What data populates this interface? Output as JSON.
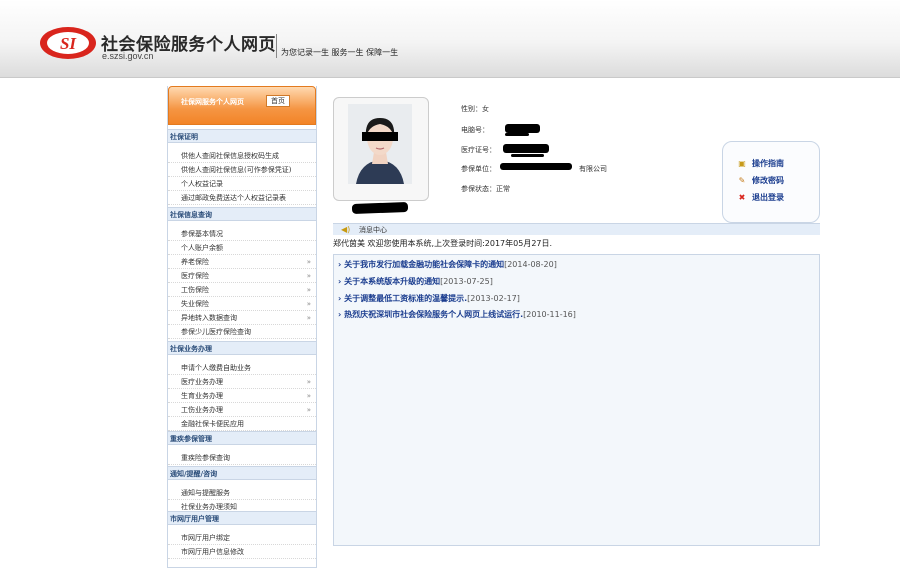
{
  "header": {
    "title": "社会保险服务个人网页",
    "url": "e.szsi.gov.cn",
    "slogan": "为您记录一生 服务一生 保障一生",
    "logo_text": "SI"
  },
  "sidebar": {
    "head_title": "社保网服务个人网页",
    "home_label": "首页",
    "sections": [
      {
        "label": "社保证明",
        "items": [
          {
            "label": "供他人查阅社保信息授权码生成",
            "arrow": ""
          },
          {
            "label": "供他人查阅社保信息(可作参保凭证)",
            "arrow": ""
          },
          {
            "label": "个人权益记录",
            "arrow": ""
          },
          {
            "label": "通过邮政免费送达个人权益记录表",
            "arrow": ""
          }
        ]
      },
      {
        "label": "社保信息查询",
        "items": [
          {
            "label": "参保基本情况",
            "arrow": ""
          },
          {
            "label": "个人账户余额",
            "arrow": ""
          },
          {
            "label": "养老保险",
            "arrow": "»"
          },
          {
            "label": "医疗保险",
            "arrow": "»"
          },
          {
            "label": "工伤保险",
            "arrow": "»"
          },
          {
            "label": "失业保险",
            "arrow": "»"
          },
          {
            "label": "异地转入数据查询",
            "arrow": "»"
          },
          {
            "label": "参保少儿医疗保险查询",
            "arrow": ""
          }
        ]
      },
      {
        "label": "社保业务办理",
        "items": [
          {
            "label": "申请个人缴费自助业务",
            "arrow": ""
          },
          {
            "label": "医疗业务办理",
            "arrow": "»"
          },
          {
            "label": "生育业务办理",
            "arrow": "»"
          },
          {
            "label": "工伤业务办理",
            "arrow": "»"
          },
          {
            "label": "金融社保卡便民应用",
            "arrow": ""
          }
        ]
      },
      {
        "label": "重疾参保管理",
        "items": [
          {
            "label": "重疾险参保查询",
            "arrow": ""
          }
        ]
      },
      {
        "label": "通知/提醒/咨询",
        "items": [
          {
            "label": "通知与提醒服务",
            "arrow": ""
          },
          {
            "label": "社保业务办理须知",
            "arrow": ""
          }
        ]
      },
      {
        "label": "市网厅用户管理",
        "items": [
          {
            "label": "市网厅用户绑定",
            "arrow": ""
          },
          {
            "label": "市网厅用户信息修改",
            "arrow": ""
          }
        ]
      }
    ]
  },
  "profile": {
    "gender": "性别：女",
    "phone_label": "电脑号：",
    "medical_label": "医疗证号：",
    "unit_label": "参保单位：",
    "unit_value_tail": "有限公司",
    "status": "参保状态：正常"
  },
  "quick_links": [
    {
      "label": "操作指南",
      "icon": "book-icon"
    },
    {
      "label": "修改密码",
      "icon": "pencil-icon"
    },
    {
      "label": "退出登录",
      "icon": "close-icon"
    }
  ],
  "messages": {
    "title": "消息中心",
    "welcome": "郑代茵美 欢迎您使用本系统,上次登录时间:2017年05月27日.",
    "notices": [
      {
        "title": "关于我市发行加载金融功能社会保障卡的通知",
        "date": "[2014-08-20]"
      },
      {
        "title": "关于本系统版本升级的通知",
        "date": "[2013-07-25]"
      },
      {
        "title": "关于调整最低工资标准的温馨提示.",
        "date": "[2013-02-17]"
      },
      {
        "title": "热烈庆祝深圳市社会保险服务个人网页上线试运行.",
        "date": "[2010-11-16]"
      }
    ]
  },
  "colors": {
    "accent_orange": "#f28427",
    "link_blue": "#1b3d8f",
    "section_bg": "#e4edf8",
    "logo_red": "#d9251d"
  }
}
